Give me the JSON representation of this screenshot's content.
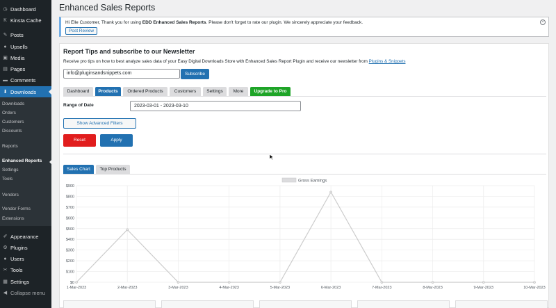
{
  "sidebar": {
    "items": [
      {
        "label": "Dashboard",
        "icon": "dashboard-icon",
        "glyph": "◷"
      },
      {
        "label": "Kinsta Cache",
        "icon": "kinsta-icon",
        "glyph": "K"
      },
      {
        "label": "Posts",
        "icon": "pin-icon",
        "glyph": "✎"
      },
      {
        "label": "Upsells",
        "icon": "upsells-icon",
        "glyph": "●"
      },
      {
        "label": "Media",
        "icon": "media-icon",
        "glyph": "▣"
      },
      {
        "label": "Pages",
        "icon": "pages-icon",
        "glyph": "▤"
      },
      {
        "label": "Comments",
        "icon": "comments-icon",
        "glyph": "▬"
      },
      {
        "label": "Downloads",
        "icon": "downloads-icon",
        "glyph": "⬇"
      }
    ],
    "downloads_sub": [
      "Downloads",
      "Orders",
      "Customers",
      "Discounts",
      "Reports",
      "Enhanced Reports",
      "Settings",
      "Tools",
      "Vendors",
      "Vendor Forms",
      "Extensions"
    ],
    "bottom_items": [
      {
        "label": "Appearance",
        "icon": "appearance-icon",
        "glyph": "✐"
      },
      {
        "label": "Plugins",
        "icon": "plugins-icon",
        "glyph": "⚙"
      },
      {
        "label": "Users",
        "icon": "users-icon",
        "glyph": "●"
      },
      {
        "label": "Tools",
        "icon": "tools-icon",
        "glyph": "✂"
      },
      {
        "label": "Settings",
        "icon": "settings-icon",
        "glyph": "▦"
      },
      {
        "label": "Collapse menu",
        "icon": "collapse-icon",
        "glyph": "◀"
      }
    ]
  },
  "page": {
    "title": "Enhanced Sales Reports"
  },
  "notice": {
    "text_prefix": "Hi Elle Customer, Thank you for using ",
    "text_bold": "EDD Enhanced Sales Reports",
    "text_suffix": ". Please don't forget to rate our plugin. We sincerely appreciate your feedback.",
    "button": "Post Review",
    "close_glyph": "×"
  },
  "newsletter": {
    "heading": "Report Tips and subscribe to our Newsletter",
    "desc": "Receive pro tips on how to best analyze sales data of your Easy Digital Downloads Store with Enhanced Sales Report Plugin and receive our newsletter from ",
    "link": "Plugins & Snippets",
    "email_value": "info@pluginsandsnippets.com",
    "subscribe": "Subscribe"
  },
  "tabs": [
    "Dashboard",
    "Products",
    "Ordered Products",
    "Customers",
    "Settings",
    "More",
    "Upgrade to Pro"
  ],
  "filters": {
    "range_label": "Range of Date",
    "range_value": "2023-03-01 - 2023-03-10",
    "advanced": "Show Advanced Filters",
    "reset": "Reset",
    "apply": "Apply"
  },
  "chart_tabs": [
    "Sales Chart",
    "Top Products"
  ],
  "chart_data": {
    "type": "line",
    "categories": [
      "1-Mar-2023",
      "2-Mar-2023",
      "3-Mar-2023",
      "4-Mar-2023",
      "5-Mar-2023",
      "6-Mar-2023",
      "7-Mar-2023",
      "8-Mar-2023",
      "9-Mar-2023",
      "10-Mar-2023"
    ],
    "series": [
      {
        "name": "Gross Earnings",
        "values": [
          0,
          490,
          0,
          0,
          0,
          840,
          0,
          0,
          0,
          0
        ]
      }
    ],
    "yticks": [
      "$0",
      "$100",
      "$200",
      "$300",
      "$400",
      "$500",
      "$600",
      "$700",
      "$800",
      "$900"
    ],
    "ylim": [
      0,
      900
    ],
    "legend": "top-center",
    "grid": true,
    "line_color": "#cccccc"
  },
  "colors": {
    "sidebar_bg": "#1d2327",
    "accent": "#2271b1",
    "reset": "#e11d1d",
    "upgrade": "#1ea427"
  }
}
